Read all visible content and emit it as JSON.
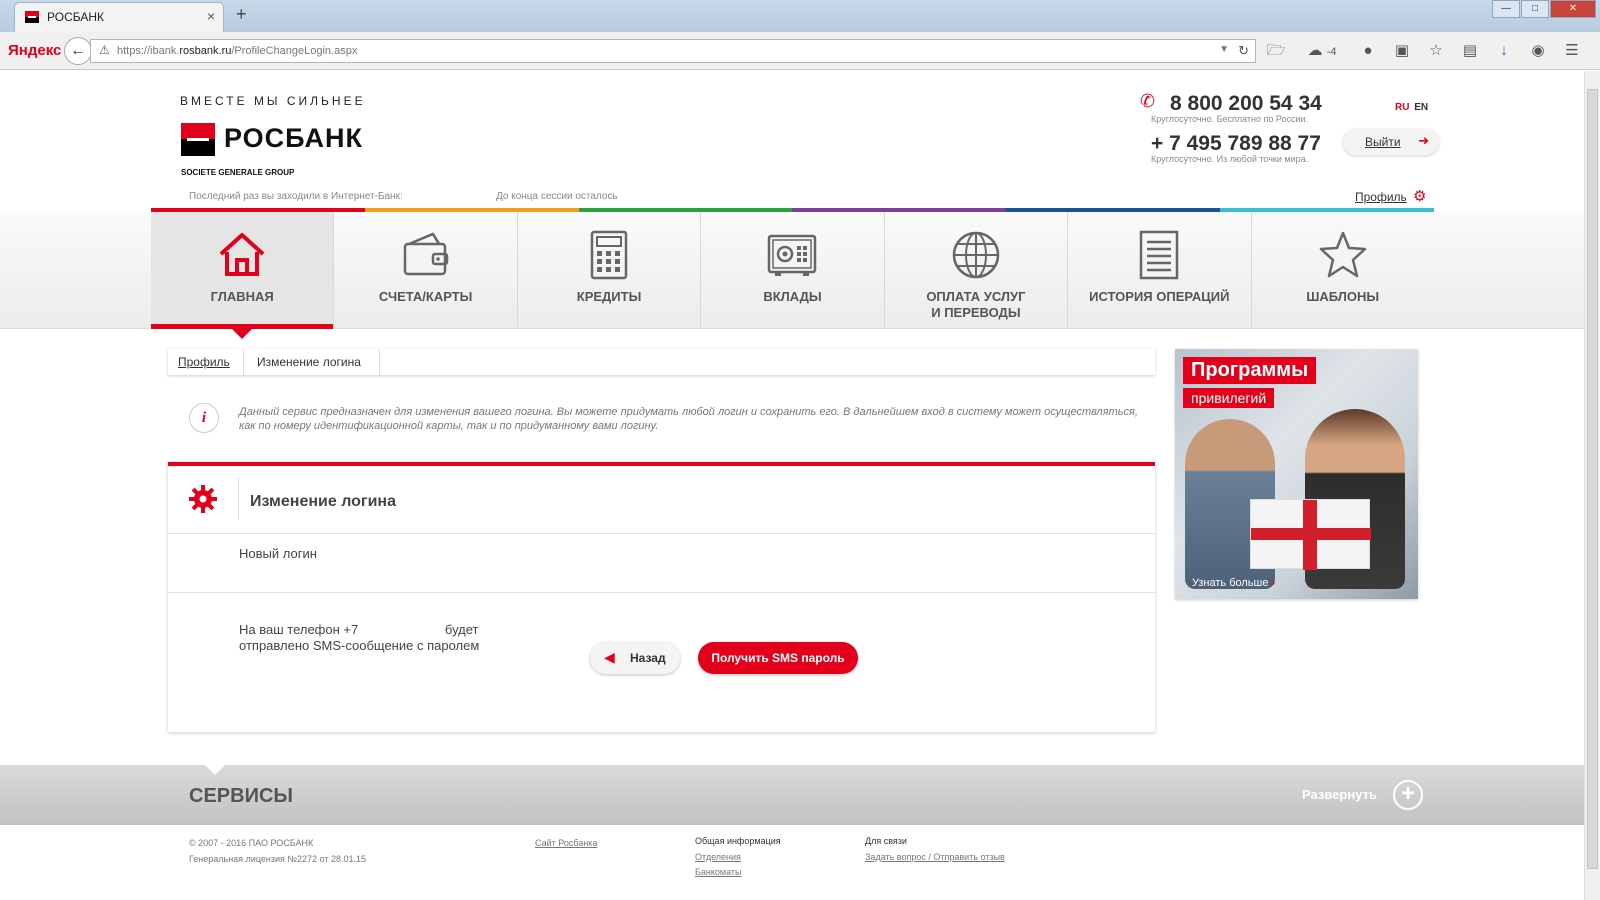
{
  "browser": {
    "tab_title": "РОСБАНК",
    "new_tab": "+",
    "close_tab": "×",
    "yandex_logo_main": "Яндекс",
    "url_prefix": "https://ibank.",
    "url_domain": "rosbank.ru",
    "url_path": "/ProfileChangeLogin.aspx",
    "weather_badge": "-4"
  },
  "header": {
    "slogan": "ВМЕСТЕ МЫ СИЛЬНЕЕ",
    "bank_name": "РОСБАНК",
    "group": "SOCIETE GENERALE GROUP",
    "phone1": "8 800 200 54 34",
    "phone1_note": "Круглосуточно. Бесплатно по России.",
    "phone2": "+ 7 495 789 88 77",
    "phone2_note": "Круглосуточно. Из любой точки мира.",
    "lang_ru": "RU",
    "lang_en": "EN",
    "logout": "Выйти",
    "last_visit": "Последний раз вы заходили в Интернет-Банк:",
    "session": "До конца сессии осталось",
    "profile": "Профиль"
  },
  "colors": {
    "accent": "#e2001a",
    "strip": [
      "#e2001a",
      "#f39c1e",
      "#27a23c",
      "#7b3f98",
      "#1c4f9c",
      "#3bbfcf"
    ]
  },
  "menu": [
    {
      "label": "ГЛАВНАЯ",
      "icon": "home-icon",
      "active": true
    },
    {
      "label": "СЧЕТА/КАРТЫ",
      "icon": "wallet-icon",
      "active": false
    },
    {
      "label": "КРЕДИТЫ",
      "icon": "calculator-icon",
      "active": false
    },
    {
      "label": "ВКЛАДЫ",
      "icon": "safe-icon",
      "active": false
    },
    {
      "label": "ОПЛАТА УСЛУГ\nИ ПЕРЕВОДЫ",
      "icon": "globe-icon",
      "active": false
    },
    {
      "label": "ИСТОРИЯ ОПЕРАЦИЙ",
      "icon": "list-icon",
      "active": false
    },
    {
      "label": "ШАБЛОНЫ",
      "icon": "star-icon",
      "active": false
    }
  ],
  "breadcrumb": {
    "profile": "Профиль",
    "current": "Изменение логина"
  },
  "info": {
    "text": "Данный сервис предназначен для изменения вашего логина. Вы можете придумать любой логин и сохранить его. В дальнейшем вход в систему может осуществляться, как по номеру идентификационной карты, так и по придуманному вами логину."
  },
  "form": {
    "title": "Изменение логина",
    "new_login_label": "Новый логин",
    "sms_text_line1": "На ваш телефон +7                        будет",
    "sms_text_line2": "отправлено SMS-сообщение с паролем",
    "back_label": "Назад",
    "sms_button_label": "Получить SMS пароль"
  },
  "banner": {
    "title": "Программы",
    "subtitle": "привилегий",
    "more": "Узнать больше"
  },
  "services": {
    "title": "СЕРВИСЫ",
    "expand": "Развернуть"
  },
  "footer": {
    "copyright_line1": "© 2007 - 2016 ПАО РОСБАНК",
    "copyright_line2": "Генеральная лицензия №2272 от 28.01.15",
    "site_link": "Сайт Росбанка",
    "general_head": "Общая информация",
    "branches": "Отделения",
    "atms": "Банкоматы",
    "contact_head": "Для связи",
    "ask": "Задать вопрос / Отправить отзыв"
  }
}
